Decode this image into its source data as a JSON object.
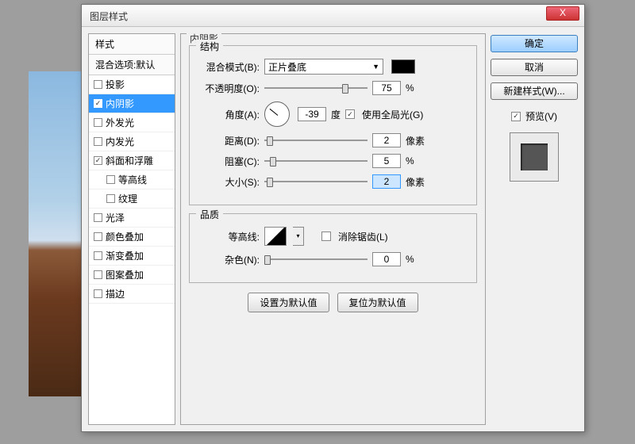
{
  "window": {
    "title": "图层样式",
    "close": "X"
  },
  "styles": {
    "header": "样式",
    "blend_header": "混合选项:默认",
    "items": [
      {
        "label": "投影",
        "checked": false,
        "indent": false
      },
      {
        "label": "内阴影",
        "checked": true,
        "indent": false,
        "selected": true
      },
      {
        "label": "外发光",
        "checked": false,
        "indent": false
      },
      {
        "label": "内发光",
        "checked": false,
        "indent": false
      },
      {
        "label": "斜面和浮雕",
        "checked": true,
        "indent": false
      },
      {
        "label": "等高线",
        "checked": false,
        "indent": true
      },
      {
        "label": "纹理",
        "checked": false,
        "indent": true
      },
      {
        "label": "光泽",
        "checked": false,
        "indent": false
      },
      {
        "label": "颜色叠加",
        "checked": false,
        "indent": false
      },
      {
        "label": "渐变叠加",
        "checked": false,
        "indent": false
      },
      {
        "label": "图案叠加",
        "checked": false,
        "indent": false
      },
      {
        "label": "描边",
        "checked": false,
        "indent": false
      }
    ]
  },
  "panel": {
    "title": "内阴影",
    "structure": {
      "label": "结构",
      "blend_mode_label": "混合模式(B):",
      "blend_mode_value": "正片叠底",
      "color": "#000000",
      "opacity_label": "不透明度(O):",
      "opacity_value": "75",
      "opacity_unit": "%",
      "angle_label": "角度(A):",
      "angle_value": "-39",
      "angle_unit": "度",
      "global_light": "使用全局光(G)",
      "global_light_checked": true,
      "distance_label": "距离(D):",
      "distance_value": "2",
      "distance_unit": "像素",
      "choke_label": "阻塞(C):",
      "choke_value": "5",
      "choke_unit": "%",
      "size_label": "大小(S):",
      "size_value": "2",
      "size_unit": "像素"
    },
    "quality": {
      "label": "品质",
      "contour_label": "等高线:",
      "antialias": "消除锯齿(L)",
      "antialias_checked": false,
      "noise_label": "杂色(N):",
      "noise_value": "0",
      "noise_unit": "%"
    },
    "set_default": "设置为默认值",
    "reset_default": "复位为默认值"
  },
  "right": {
    "ok": "确定",
    "cancel": "取消",
    "new_style": "新建样式(W)...",
    "preview": "预览(V)",
    "preview_checked": true
  }
}
